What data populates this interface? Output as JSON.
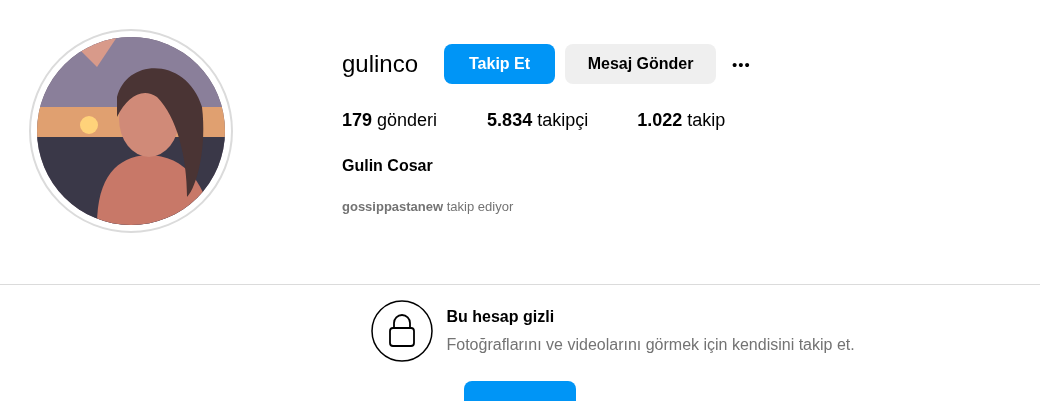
{
  "profile": {
    "username": "gulinco",
    "follow_button": "Takip Et",
    "message_button": "Mesaj Gönder",
    "more_button": "•••",
    "stats": [
      "**179** gönderi",
      "**5.834** takipçi",
      "**1.022** takip"
    ],
    "full_name": "Gulin Cosar",
    "followed_by": "**gossippastanew** takip ediyor"
  },
  "private_notice": {
    "title": "Bu hesap gizli",
    "message": "Fotoğraflarını ve videolarını görmek için kendisini takip et."
  }
}
